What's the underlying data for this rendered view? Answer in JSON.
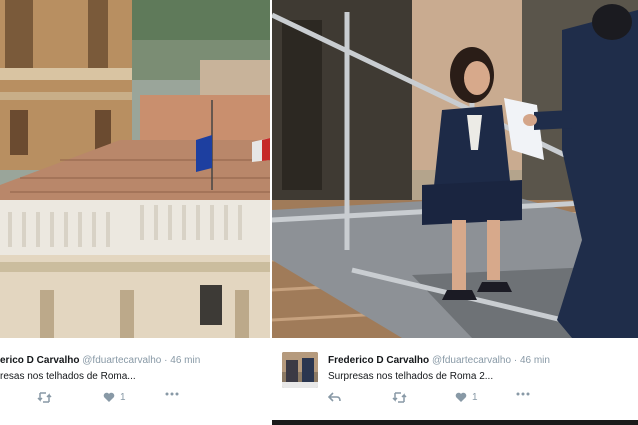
{
  "left_tweet": {
    "author_name": "erico D Carvalho",
    "handle": "@fduartecarvalho",
    "separator": "·",
    "time": "46 min",
    "text": "resas nos telhados de Roma...",
    "like_count": "1",
    "icons": [
      "retweet-icon",
      "heart-icon",
      "more-icon"
    ]
  },
  "right_tweet": {
    "author_name": "Frederico D Carvalho",
    "handle": "@fduartecarvalho",
    "separator": "·",
    "time": "46 min",
    "text": "Surpresas nos telhados de Roma 2...",
    "like_count": "1",
    "icons": [
      "reply-icon",
      "retweet-icon",
      "heart-icon",
      "more-icon"
    ]
  },
  "colors": {
    "text": "#14171a",
    "secondary": "#8899a6",
    "sky_sea": "#6f8b8e"
  }
}
